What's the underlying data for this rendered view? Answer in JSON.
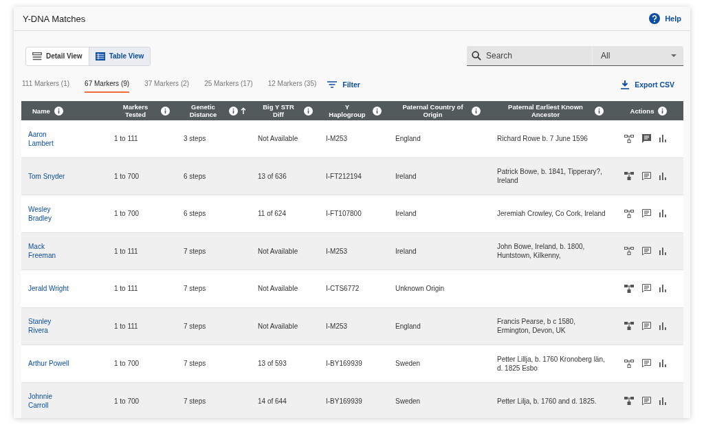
{
  "page": {
    "title": "Y-DNA Matches",
    "help": "Help"
  },
  "view_toggle": [
    {
      "label": "Detail View",
      "kind": "detail",
      "selected": false
    },
    {
      "label": "Table View",
      "kind": "table",
      "selected": true
    }
  ],
  "search": {
    "placeholder": "Search"
  },
  "scope_select": {
    "value": "All"
  },
  "marker_tabs": [
    {
      "label": "111 Markers (1)",
      "selected": false
    },
    {
      "label": "67 Markers (9)",
      "selected": true
    },
    {
      "label": "37 Markers (2)",
      "selected": false
    },
    {
      "label": "25 Markers (17)",
      "selected": false
    },
    {
      "label": "12 Markers (35)",
      "selected": false
    }
  ],
  "filter": {
    "label": "Filter"
  },
  "export": {
    "label": "Export CSV"
  },
  "table": {
    "columns": [
      {
        "label": "Name",
        "sorted": false
      },
      {
        "label": "Markers Tested",
        "sorted": false
      },
      {
        "label": "Genetic Distance",
        "sorted": true
      },
      {
        "label": "Big Y STR Diff",
        "sorted": false
      },
      {
        "label": "Y Haplogroup",
        "sorted": false
      },
      {
        "label": "Paternal Country of Origin",
        "sorted": false
      },
      {
        "label": "Paternal Earliest Known Ancestor",
        "sorted": false
      },
      {
        "label": "Actions",
        "sorted": false
      }
    ],
    "rows": [
      {
        "name": "Aaron Lambert",
        "markers_tested": "1 to 111",
        "genetic_distance": "3 steps",
        "big_y_str_diff": "Not Available",
        "haplogroup": "I-M253",
        "country": "England",
        "ancestor": "Richard Rowe b. 7 June 1596",
        "tree_linked": false,
        "has_note": true
      },
      {
        "name": "Tom Snyder",
        "markers_tested": "1 to 700",
        "genetic_distance": "6 steps",
        "big_y_str_diff": "13 of 636",
        "haplogroup": "I-FT212194",
        "country": "Ireland",
        "ancestor": "Patrick Bowe, b. 1841, Tipperary?, Ireland",
        "tree_linked": true,
        "has_note": false
      },
      {
        "name": "Wesley Bradley",
        "markers_tested": "1 to 700",
        "genetic_distance": "6 steps",
        "big_y_str_diff": "11 of 624",
        "haplogroup": "I-FT107800",
        "country": "Ireland",
        "ancestor": "Jeremiah Crowley, Co Cork, Ireland",
        "tree_linked": false,
        "has_note": false
      },
      {
        "name": "Mack Freeman",
        "markers_tested": "1 to 111",
        "genetic_distance": "7 steps",
        "big_y_str_diff": "Not Available",
        "haplogroup": "I-M253",
        "country": "Ireland",
        "ancestor": "John Bowe, Ireland, b. 1800, Huntstown, Kilkenny,",
        "tree_linked": false,
        "has_note": false
      },
      {
        "name": "Jerald Wright",
        "markers_tested": "1 to 111",
        "genetic_distance": "7 steps",
        "big_y_str_diff": "Not Available",
        "haplogroup": "I-CTS6772",
        "country": "Unknown Origin",
        "tree_linked": true,
        "has_note": false
      },
      {
        "name": "Stanley Rivera",
        "markers_tested": "1 to 111",
        "genetic_distance": "7 steps",
        "big_y_str_diff": "Not Available",
        "haplogroup": "I-M253",
        "country": "England",
        "ancestor": "Francis Pearse, b c 1580, Ermington, Devon, UK",
        "tree_linked": true,
        "has_note": false
      },
      {
        "name": "Arthur Powell",
        "markers_tested": "1 to 700",
        "genetic_distance": "7 steps",
        "big_y_str_diff": "13 of 593",
        "haplogroup": "I-BY169939",
        "country": "Sweden",
        "ancestor": "Petter Lillja, b. 1760 Kronoberg län, d. 1825 Esbo",
        "tree_linked": false,
        "has_note": false
      },
      {
        "name": "Johnnie Carroll",
        "markers_tested": "1 to 700",
        "genetic_distance": "7 steps",
        "big_y_str_diff": "14 of 644",
        "haplogroup": "I-BY169939",
        "country": "Sweden",
        "ancestor": "Petter Lilja, b. 1760 and d. 1825.",
        "tree_linked": true,
        "has_note": false
      }
    ]
  }
}
